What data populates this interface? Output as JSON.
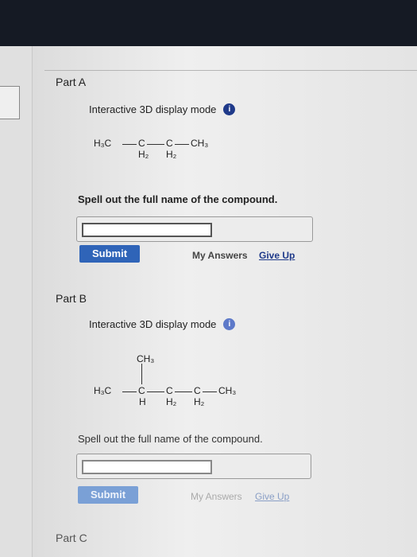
{
  "partA": {
    "label": "Part A",
    "display_mode": "Interactive 3D display mode",
    "info_icon": "i",
    "formula": {
      "left": "H₃C",
      "c1": "C",
      "c2": "C",
      "right": "CH₃",
      "h1": "H₂",
      "h2": "H₂"
    },
    "prompt": "Spell out the full name of the compound.",
    "answer_value": "",
    "submit_label": "Submit",
    "my_answers": "My Answers",
    "give_up": "Give Up"
  },
  "partB": {
    "label": "Part B",
    "display_mode": "Interactive 3D display mode",
    "info_icon": "i",
    "formula": {
      "top": "CH₃",
      "left": "H₃C",
      "c1": "C",
      "c2": "C",
      "c3": "C",
      "right": "CH₃",
      "h1": "H",
      "h2": "H₂",
      "h3": "H₂"
    },
    "prompt": "Spell out the full name of the compound.",
    "answer_value": "",
    "submit_label": "Submit",
    "my_answers": "My Answers",
    "give_up": "Give Up"
  },
  "partC": {
    "label": "Part C"
  },
  "colors": {
    "topbar": "#151a24",
    "submit": "#2f64b8",
    "link": "#1f3a8a"
  }
}
